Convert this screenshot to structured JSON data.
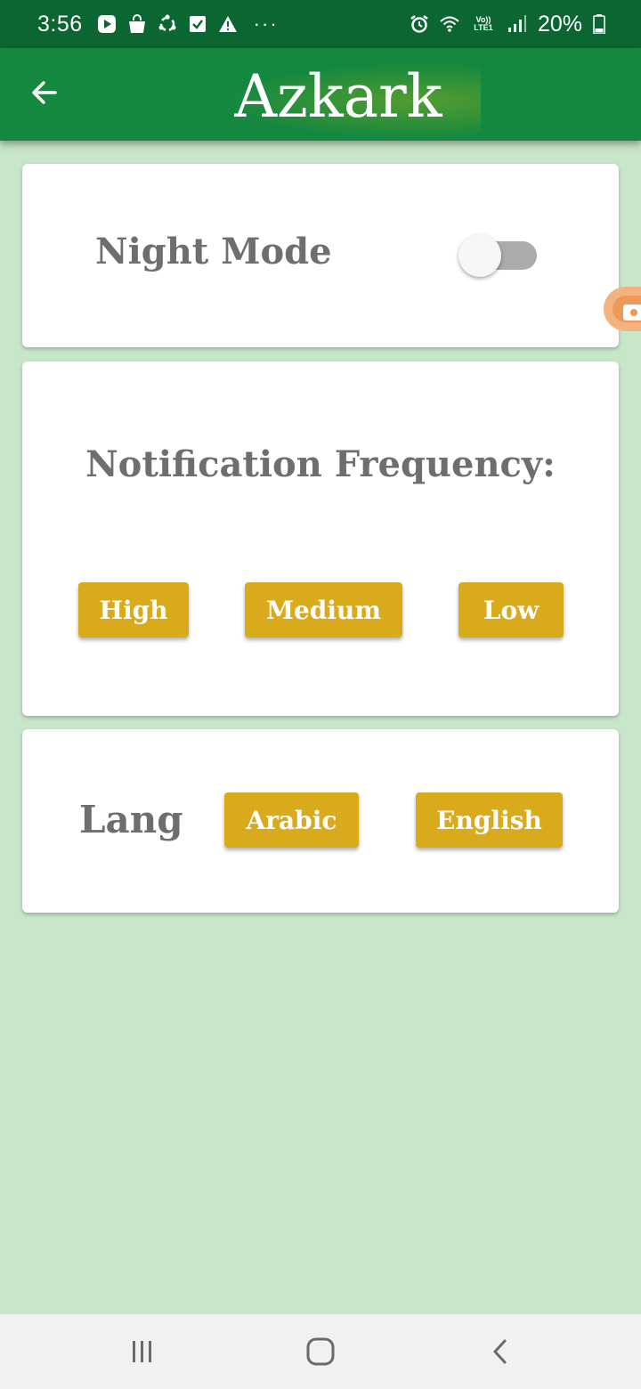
{
  "status_bar": {
    "time": "3:56",
    "left_icons": [
      "play-store-icon",
      "shopping-bag-icon",
      "sync-icon",
      "checkbox-icon",
      "warning-icon"
    ],
    "more": "···",
    "lte_top": "Vo))",
    "lte_bottom": "LTE1",
    "battery_percent": "20%",
    "right_icons": [
      "alarm-icon",
      "wifi-icon",
      "signal-icon",
      "battery-icon"
    ]
  },
  "app_bar": {
    "title": "Azkark",
    "back_icon": "arrow-left-icon"
  },
  "settings": {
    "night_mode": {
      "label": "Night Mode",
      "enabled": false
    },
    "notification": {
      "label": "Notification Frequency:",
      "options": [
        "High",
        "Medium",
        "Low"
      ]
    },
    "language": {
      "label": "Lang",
      "options": [
        "Arabic",
        "English"
      ]
    }
  },
  "nav_bar": {
    "buttons": [
      "recents-icon",
      "home-icon",
      "back-chevron-icon"
    ]
  },
  "colors": {
    "status_bar": "#0c6632",
    "app_bar": "#15883f",
    "background": "#c8e6ca",
    "button": "#d9aa1c",
    "label_text": "#6e6e6e"
  }
}
